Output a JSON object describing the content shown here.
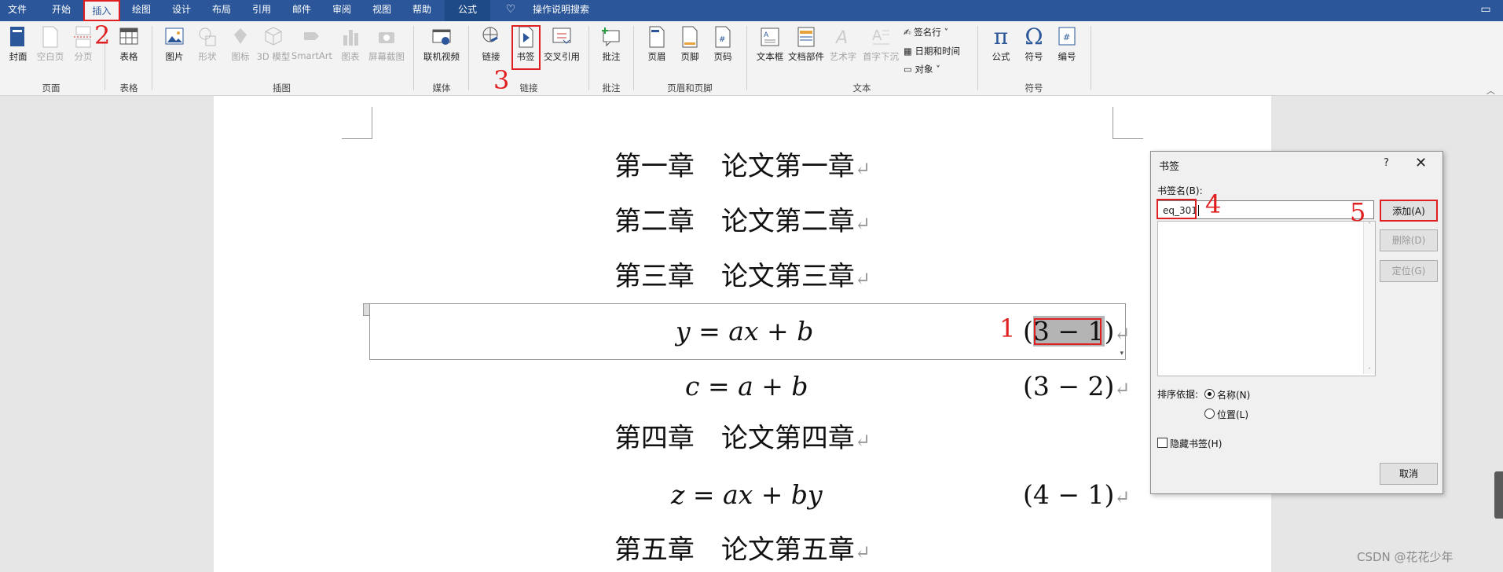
{
  "menu": {
    "tabs": [
      "文件",
      "开始",
      "插入",
      "绘图",
      "设计",
      "布局",
      "引用",
      "邮件",
      "审阅",
      "视图",
      "帮助",
      "公式"
    ],
    "search": "操作说明搜索"
  },
  "ribbon": {
    "page": {
      "cover": "封面",
      "blank_page": "空白页",
      "page_break": "分页",
      "group": "页面"
    },
    "table": {
      "table": "表格",
      "group": "表格"
    },
    "illustrations": {
      "picture": "图片",
      "shapes": "形状",
      "icons": "图标",
      "model3d": "3D 模型",
      "smartart": "SmartArt",
      "chart": "图表",
      "screenshot": "屏幕截图",
      "group": "插图"
    },
    "media": {
      "online_video": "联机视频",
      "group": "媒体"
    },
    "links": {
      "link": "链接",
      "bookmark": "书签",
      "cross_ref": "交叉引用",
      "group": "链接"
    },
    "comments": {
      "comment": "批注",
      "group": "批注"
    },
    "header_footer": {
      "header": "页眉",
      "footer": "页脚",
      "page_number": "页码",
      "group": "页眉和页脚"
    },
    "text": {
      "text_box": "文本框",
      "quick_parts": "文档部件",
      "wordart": "艺术字",
      "drop_cap": "首字下沉",
      "signature": "签名行",
      "date_time": "日期和时间",
      "object": "对象",
      "group": "文本"
    },
    "symbols": {
      "equation": "公式",
      "symbol": "符号",
      "numbering": "编号",
      "group": "符号"
    }
  },
  "document": {
    "headings": [
      "第一章　论文第一章",
      "第二章　论文第二章",
      "第三章　论文第三章",
      "第四章　论文第四章",
      "第五章　论文第五章"
    ],
    "equations": [
      {
        "formula": "y = ax + b",
        "number_open": "(",
        "number_inner": "3 − 1",
        "number_close": ")"
      },
      {
        "formula": "c = a + b",
        "number": "(3 − 2)"
      },
      {
        "formula": "z = ax + by",
        "number": "(4 − 1)"
      }
    ],
    "return_mark": "↵"
  },
  "dialog": {
    "title": "书签",
    "help": "?",
    "close": "✕",
    "name_label": "书签名(B):",
    "name_value": "eq_301",
    "add": "添加(A)",
    "delete": "删除(D)",
    "goto": "定位(G)",
    "sort_label": "排序依据:",
    "sort_name": "名称(N)",
    "sort_location": "位置(L)",
    "hidden": "隐藏书签(H)",
    "cancel": "取消"
  },
  "annotations": [
    "1",
    "2",
    "3",
    "4",
    "5"
  ],
  "watermark": "CSDN @花花少年",
  "colors": {
    "title_bar": "#2b579a",
    "annotation_red": "#e02020",
    "ribbon_bg": "#f3f3f3"
  }
}
